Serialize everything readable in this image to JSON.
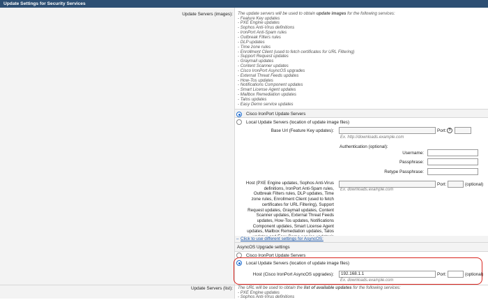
{
  "header": {
    "title": "Update Settings for Security Services"
  },
  "images": {
    "label": "Update Servers (images):",
    "intro_pre": "The update servers will be used to obtain ",
    "intro_bold": "update images",
    "intro_post": " for the following services:",
    "services": [
      "- Feature Key updates",
      "- PXE Engine updates",
      "- Sophos Anti-Virus definitions",
      "- IronPort Anti-Spam rules",
      "- Outbreak Filters rules",
      "- DLP updates",
      "- Time zone rules",
      "- Enrollment Client (used to fetch certificates for URL Filtering)",
      "- Support Request updates",
      "- Graymail updates",
      "- Content Scanner updates",
      "- Cisco IronPort AsyncOS upgrades",
      "- External Threat Feeds updates",
      "- How-Tos updates",
      "- Notifications Component updates",
      "- Smart License Agent updates",
      "- Mailbox Remediation updates",
      "- Talos updates",
      "- Easy Demo service updates"
    ],
    "opt_cisco": "Cisco IronPort Update Servers",
    "opt_local": "Local Update Servers (location of update image files)",
    "base_url_label": "Base Url (Feature Key updates):",
    "base_url_value": "",
    "port_label": "Port:",
    "base_url_hint": "Ex. http://downloads.example.com",
    "auth_label": "Authentication (optional):",
    "username_label": "Username:",
    "passphrase_label": "Passphrase:",
    "retype_label": "Retype Passphrase:",
    "host_label_lines": [
      "Host (PXE Engine updates, Sophos Anti-Virus",
      "definitions, IronPort Anti-Spam rules,",
      "Outbreak Filters rules, DLP updates, Time",
      "zone rules, Enrollment Client (used to fetch",
      "certificates for URL Filtering), Support",
      "Request updates, Graymail updates, Content",
      "Scanner updates, External Threat Feeds",
      "updates, How-Tos updates, Notifications",
      "Component updates, Smart License Agent",
      "updates, Mailbox Remediation updates, Talos",
      "updates and Easy Demo service updates):"
    ],
    "host_hint": "Ex. downloads.example.com",
    "optional": "(optional)",
    "async_link": "Click to use different settings for AsyncOS:",
    "async_header": "AsyncOS Upgrade settings",
    "async_opt_cisco": "Cisco IronPort Update Servers",
    "async_opt_local": "Local Update Servers (location of update image files)",
    "async_host_label": "Host (Cisco IronPort AsyncOS upgrades):",
    "async_host_value": "192.168.1.1",
    "async_host_hint": "Ex. downloads.example.com"
  },
  "list": {
    "label": "Update Servers (list):",
    "intro_pre": "The URL will be used to obtain the ",
    "intro_bold": "list of available updates",
    "intro_post": " for the following services:",
    "services": [
      "- PXE Engine updates",
      "- Sophos Anti-Virus definitions"
    ]
  }
}
